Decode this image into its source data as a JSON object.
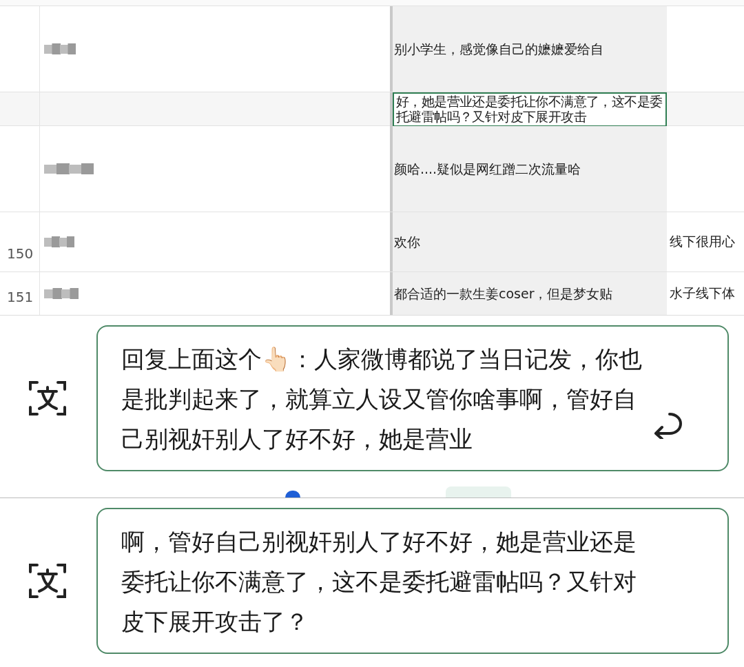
{
  "sheet": {
    "rows": [
      {
        "number": "",
        "column_3": "别小学生，感觉像自己的嬷嬷爱给自",
        "column_4": "",
        "selected": false
      },
      {
        "number": "",
        "column_3": "好，她是营业还是委托让你不满意了，这不是委托避雷帖吗？又针对皮下展开攻击",
        "column_4": "",
        "selected": true
      },
      {
        "number": "",
        "column_3": "颜哈....疑似是网红蹭二次流量哈",
        "column_4": "",
        "selected": false
      },
      {
        "number": "150",
        "column_3": "欢你",
        "column_4": "线下很用心",
        "selected": false
      },
      {
        "number": "151",
        "column_3": "都合适的一款生姜coser，但是梦女贴",
        "column_4": "水子线下体",
        "selected": false
      }
    ]
  },
  "text_boxes": [
    {
      "text": "回复上面这个👆🏻：人家微博都说了当日记发，你也是批判起来了，就算立人设又管你啥事啊，管好自己别视奸别人了好不好，她是营业",
      "return_button": true
    },
    {
      "text": "啊，管好自己别视奸别人了好不好，她是营业还是委托让你不满意了，这不是委托避雷帖吗？又针对皮下展开攻击了？",
      "return_button": false
    }
  ]
}
